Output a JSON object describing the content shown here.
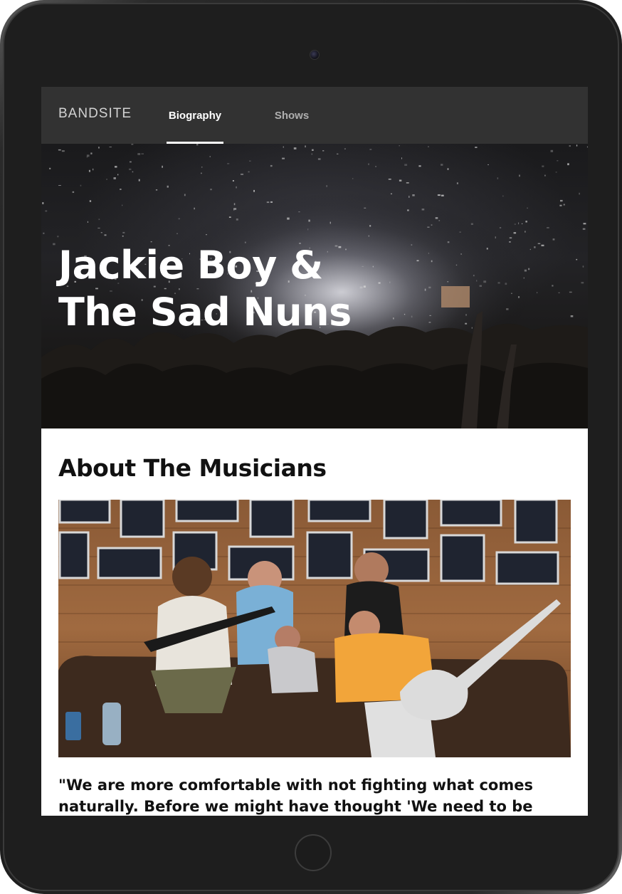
{
  "nav": {
    "logo": "BANDSITE",
    "links": [
      {
        "label": "Biography",
        "active": true
      },
      {
        "label": "Shows",
        "active": false
      }
    ]
  },
  "hero": {
    "title_line1": "Jackie Boy &",
    "title_line2": "The Sad Nuns"
  },
  "about": {
    "heading": "About The Musicians",
    "quote": "\"We are more comfortable with not fighting what comes naturally. Before we might have thought 'We need to be"
  },
  "colors": {
    "nav_bg": "#323232",
    "nav_active": "#ffffff",
    "nav_inactive": "#afafaf",
    "text": "#111111"
  }
}
